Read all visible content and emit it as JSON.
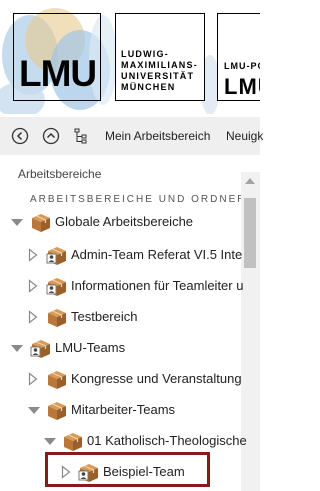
{
  "header": {
    "logo_text": "LMU",
    "university_name_lines": [
      "LUDWIG-",
      "MAXIMILIANS-",
      "UNIVERSITÄT",
      "MÜNCHEN"
    ],
    "portal_top": "LMU-PO",
    "portal_big": "LMU"
  },
  "toolbar": {
    "back_icon": "chevron-left-circle-icon",
    "up_icon": "chevron-up-circle-icon",
    "tree_icon": "sitemap-icon",
    "my_workspace_label": "Mein Arbeitsbereich",
    "news_label": "Neuigk"
  },
  "panel": {
    "title": "Arbeitsbereiche",
    "subtitle": "ARBEITSBEREICHE UND ORDNER"
  },
  "tree": {
    "items": [
      {
        "label": "Globale Arbeitsbereiche",
        "expanded": true,
        "icon": "package-icon"
      },
      {
        "label": "Admin-Team Referat VI.5 Inte",
        "expanded": false,
        "icon": "package-user-icon"
      },
      {
        "label": "Informationen für Teamleiter u",
        "expanded": false,
        "icon": "package-user-icon"
      },
      {
        "label": "Testbereich",
        "expanded": false,
        "icon": "package-icon"
      },
      {
        "label": "LMU-Teams",
        "expanded": true,
        "icon": "package-user-icon"
      },
      {
        "label": "Kongresse und Veranstaltung",
        "expanded": false,
        "icon": "package-icon"
      },
      {
        "label": "Mitarbeiter-Teams",
        "expanded": true,
        "icon": "package-icon"
      },
      {
        "label": "01 Katholisch-Theologische",
        "expanded": true,
        "icon": "package-icon"
      },
      {
        "label": "Beispiel-Team",
        "expanded": false,
        "icon": "package-user-icon"
      }
    ]
  },
  "colors": {
    "toolbar_bg": "#efefef",
    "highlight_border": "#8a1a1a",
    "box_brown": "#b9773a"
  }
}
